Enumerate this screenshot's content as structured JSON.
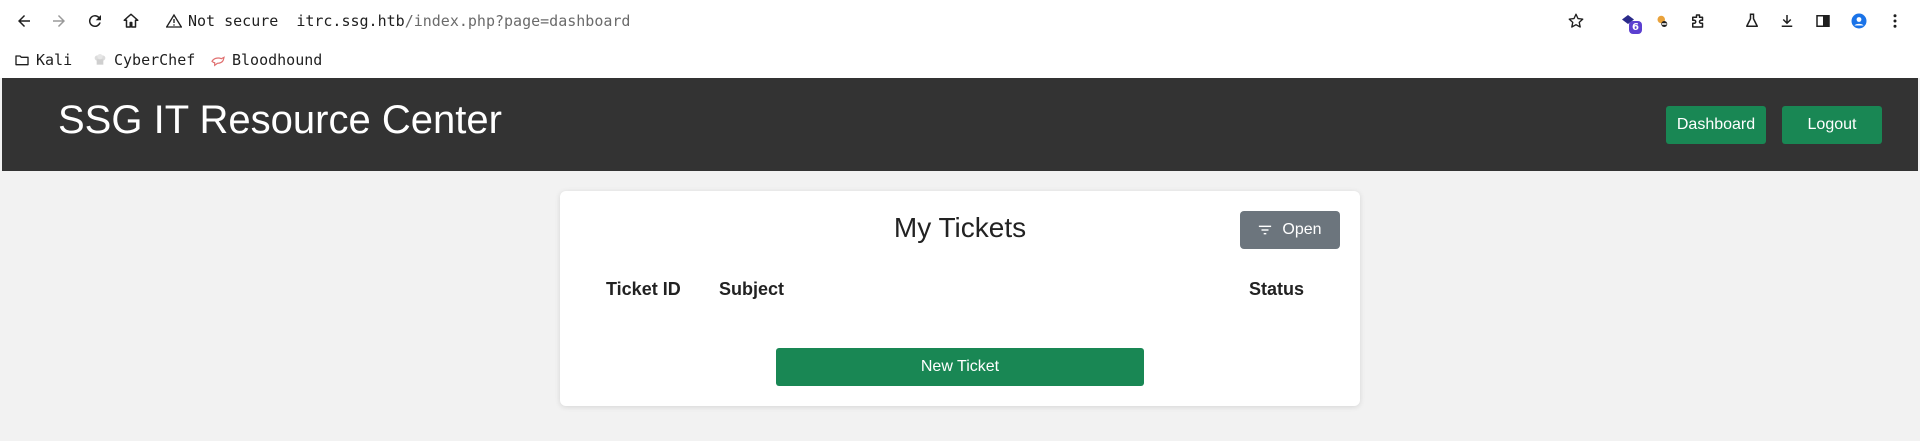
{
  "browser": {
    "security_label": "Not secure",
    "url_host": "itrc.ssg.htb",
    "url_path": "/index.php?page=dashboard",
    "extension_badge": "6",
    "icons": [
      "back-arrow-icon",
      "forward-arrow-icon",
      "reload-icon",
      "home-icon",
      "warning-icon",
      "star-icon",
      "extensions-icon",
      "flask-icon",
      "download-icon",
      "sidebar-icon",
      "profile-icon",
      "kebab-menu-icon"
    ],
    "bookmarks": [
      {
        "label": "Kali",
        "icon": "folder-icon"
      },
      {
        "label": "CyberChef",
        "icon": "chef-hat-icon"
      },
      {
        "label": "Bloodhound",
        "icon": "bloodhound-icon"
      }
    ]
  },
  "header": {
    "title": "SSG IT Resource Center",
    "dashboard_label": "Dashboard",
    "logout_label": "Logout",
    "accent_color": "#198754",
    "background_color": "#333333"
  },
  "tickets": {
    "title": "My Tickets",
    "filter_label": "Open",
    "columns": [
      "Ticket ID",
      "Subject",
      "Status"
    ],
    "rows": [],
    "new_ticket_label": "New Ticket"
  }
}
